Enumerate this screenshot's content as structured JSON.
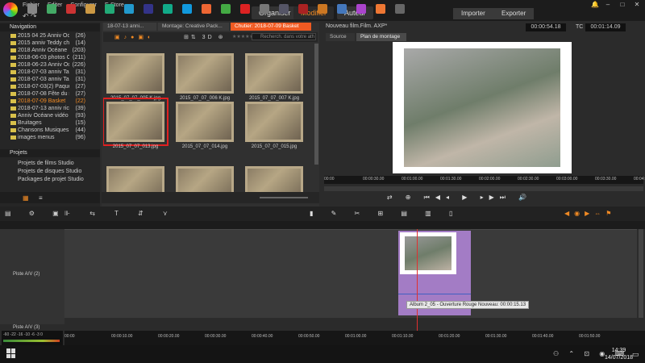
{
  "menu": [
    "Fichier",
    "Editer",
    "Configurer",
    "E-Store"
  ],
  "undo": "↶ ↷",
  "modes": {
    "organize": "Organiser",
    "edit": "Modifier",
    "audio": "Auteur"
  },
  "import": "Importer",
  "export": "Exporter",
  "window": {
    "min": "–",
    "max": "□",
    "close": "✕"
  },
  "nav": {
    "title": "Navigation",
    "items": [
      {
        "name": "2015 04 25 Anniv Océ 1...",
        "count": "(26)"
      },
      {
        "name": "2015 anniv Teddy chinois",
        "count": "(14)"
      },
      {
        "name": "2018 Anniv Océane",
        "count": "(203)"
      },
      {
        "name": "2018-06-03 photos Oc...",
        "count": "(211)"
      },
      {
        "name": "2018-06-23 Anniv Océ...",
        "count": "(226)"
      },
      {
        "name": "2018-07-03 anniv Tahiat...",
        "count": "(31)"
      },
      {
        "name": "2018-07-03 anniv Tahiat...",
        "count": "(31)"
      },
      {
        "name": "2018-07-03(2) Paques à...",
        "count": "(27)"
      },
      {
        "name": "2018-07-08 Fête du sport",
        "count": "(27)"
      },
      {
        "name": "2018-07-09 Basket",
        "count": "(22)"
      },
      {
        "name": "2018-07-13 anniv ricardo",
        "count": "(39)"
      },
      {
        "name": "Anniv Océane vidéo mer...",
        "count": "(93)"
      },
      {
        "name": "Bruitages",
        "count": "(15)"
      },
      {
        "name": "Chansons Musiques",
        "count": "(44)"
      },
      {
        "name": "images menus",
        "count": "(96)"
      }
    ]
  },
  "projects": {
    "title": "Projets",
    "items": [
      "Projets de films Studio",
      "Projets de disques Studio",
      "Packages de projet Studio"
    ]
  },
  "tabs": [
    "18-07-13 anni...",
    "Montage: Creative Pack...",
    "Chutier: 2018-07-09 Basket"
  ],
  "search_placeholder": "Recherch. dans votre ath",
  "thumbs": [
    {
      "caption": "2015_07_07_005 K.jpg"
    },
    {
      "caption": "2015_07_07_006 K.jpg"
    },
    {
      "caption": "2015_07_07_007 K.jpg"
    },
    {
      "caption": "2015_07_07_013.jpg"
    },
    {
      "caption": "2015_07_07_014.jpg"
    },
    {
      "caption": "2015_07_07_015.jpg"
    }
  ],
  "player": {
    "title": "Nouveau film.Film. AXP*",
    "timecode": "00:00:54.18",
    "tc_label": "TC",
    "tc2": "00:01:14.09",
    "tabs": [
      "Source",
      "Plan de montage"
    ],
    "ticks": [
      "00:00",
      "00:00:30.00",
      "00:01:00.00",
      "00:01:30.00",
      "00:02:00.00",
      "00:02:30.00",
      "00:03:00.00",
      "00:03:30.00",
      "00:04:00.00"
    ]
  },
  "timeline": {
    "tracks": [
      "Piste A/V (2)",
      "Piste A/V (3)"
    ],
    "tooltip": "Album 2_05 - Ouverture Rouge Nouveau: 00:00:15.13",
    "ticks": [
      "00:00",
      "00:00:10.00",
      "00:00:20.00",
      "00:00:30.00",
      "00:00:40.00",
      "00:00:50.00",
      "00:01:00.00",
      "00:01:10.00",
      "00:01:20.00",
      "00:01:30.00",
      "00:01:40.00",
      "00:01:50.00"
    ],
    "meter": "-60 -22 -16 -10 -6 -3 0"
  },
  "clock": {
    "time": "14:39",
    "date": "14/07/2018"
  }
}
